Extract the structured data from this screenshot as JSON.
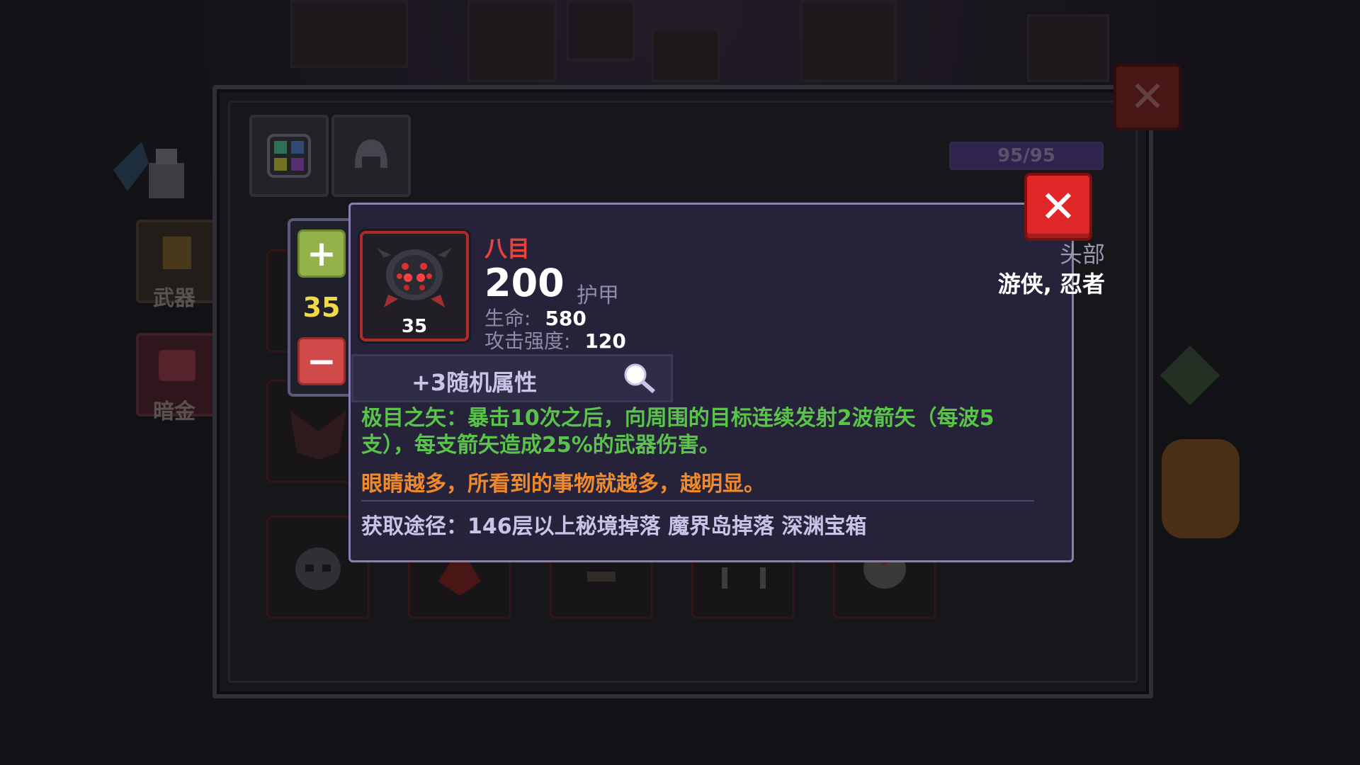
{
  "side_menu": {
    "weapon_label": "武器",
    "dark_gold_label": "暗金"
  },
  "inventory": {
    "energy_text": "95/95",
    "energy_fraction": 1.0
  },
  "stepper": {
    "plus_symbol": "+",
    "minus_symbol": "−",
    "level": "35"
  },
  "item": {
    "name": "八目",
    "icon": "spider-helmet-icon",
    "level_badge": "35",
    "main_value": "200",
    "main_label": "护甲",
    "stats": [
      {
        "label": "生命:",
        "value": "580"
      },
      {
        "label": "攻击强度:",
        "value": "120"
      }
    ],
    "slot": "头部",
    "classes": "游侠, 忍者",
    "random_attributes": "+3随机属性",
    "skill_description": "极目之矢：暴击10次之后，向周围的目标连续发射2波箭矢（每波5支），每支箭矢造成25%的武器伤害。",
    "flavor_text": "眼睛越多，所看到的事物就越多，越明显。",
    "source": "获取途径：146层以上秘境掉落 魔界岛掉落 深渊宝箱"
  },
  "colors": {
    "name": "#e8453a",
    "skill": "#5ac44a",
    "flavor": "#f0892a",
    "close_button": "#e02828"
  }
}
